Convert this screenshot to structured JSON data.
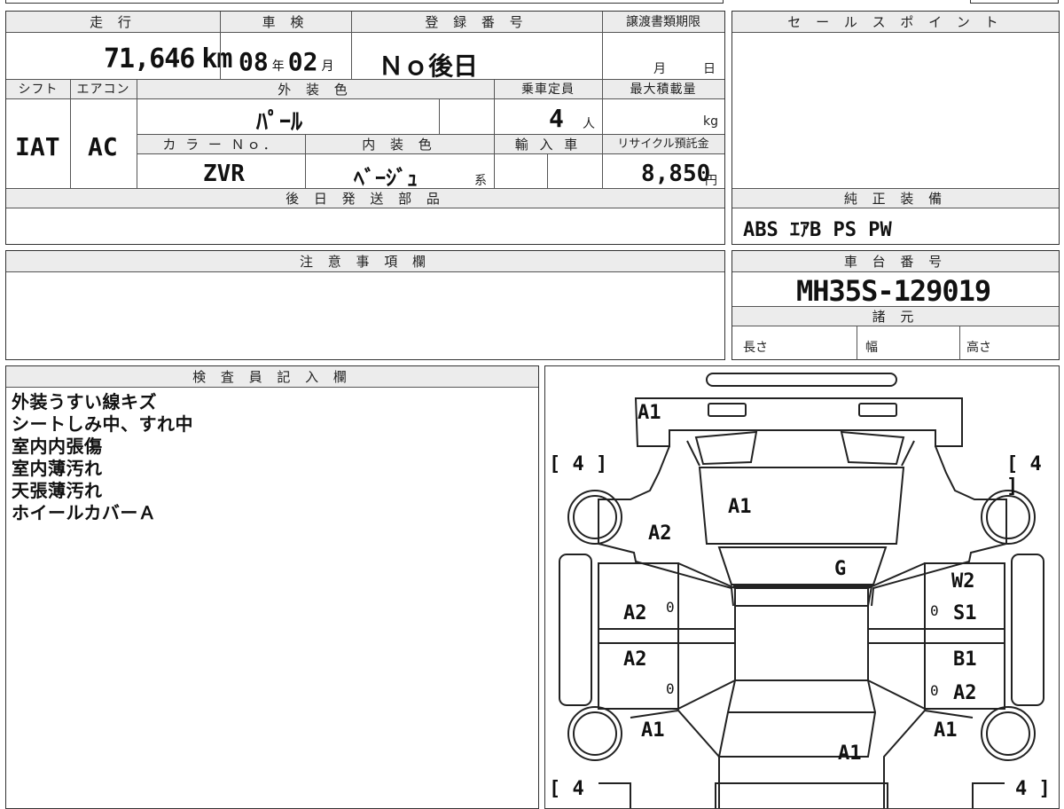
{
  "topstrip": {},
  "mileage": {
    "label": "走 行",
    "value": "71,646",
    "unit": "km"
  },
  "inspection": {
    "label": "車 検",
    "year": "08",
    "year_unit": "年",
    "month": "02",
    "month_unit": "月"
  },
  "registration": {
    "label": "登 録 番 号",
    "value": "Ｎｏ後日"
  },
  "transfer_deadline": {
    "label": "譲渡書類期限",
    "month_unit": "月",
    "day_unit": "日"
  },
  "shift": {
    "label": "シフト",
    "value": "IAT"
  },
  "aircon": {
    "label": "エアコン",
    "value": "AC"
  },
  "exterior_color": {
    "label": "外 装 色",
    "value": "ﾊﾟｰﾙ"
  },
  "capacity": {
    "label": "乗車定員",
    "value": "4",
    "unit": "人"
  },
  "max_load": {
    "label": "最大積載量",
    "unit": "kg"
  },
  "color_no": {
    "label": "カ ラ ー Ｎｏ．",
    "value": "ZVR"
  },
  "interior_color": {
    "label": "内 装 色",
    "value": "ﾍﾞｰｼﾞｭ",
    "suffix": "系"
  },
  "imported": {
    "label": "輸 入 車"
  },
  "recycle": {
    "label": "リサイクル預託金",
    "value": "8,850",
    "unit": "円"
  },
  "later_parts": {
    "label": "後 日 発 送 部 品"
  },
  "sales_point": {
    "label": "セ ー ル ス ポ イ ン ト"
  },
  "equipment": {
    "label": "純 正 装 備",
    "value": "ABS ｴｱB PS PW"
  },
  "notes": {
    "label": "注 意 事 項 欄"
  },
  "chassis": {
    "label": "車 台 番 号",
    "value": "MH35S-129019"
  },
  "specs": {
    "label": "諸 元",
    "length": "長さ",
    "width": "幅",
    "height": "高さ"
  },
  "inspector": {
    "label": "検 査 員 記 入 欄",
    "lines": [
      "外装うすい線キズ",
      "シートしみ中、すれ中",
      "室内内張傷",
      "室内薄汚れ",
      "天張薄汚れ",
      "ホイールカバーＡ"
    ]
  },
  "diagram": {
    "tire_left_front": "[ 4 ]",
    "tire_right_front": "[ 4 ]",
    "tire_left_rear": "[ 4",
    "tire_right_rear": "4 ]",
    "marks": {
      "rear_bumper": "A1",
      "rear_glass": "A1",
      "left_rear_quarter": "A2",
      "roof": "G",
      "left_rear_door": "A2",
      "left_front_door": "A2",
      "right_rear_door_a": "W2",
      "right_rear_door_b": "S1",
      "right_front_door_a": "B1",
      "right_front_door_b": "A2",
      "left_front_fender": "A1",
      "right_front_fender": "A1",
      "hood": "A1",
      "left_zero_1": "0",
      "left_zero_2": "0",
      "right_zero_1": "0",
      "right_zero_2": "0"
    }
  }
}
